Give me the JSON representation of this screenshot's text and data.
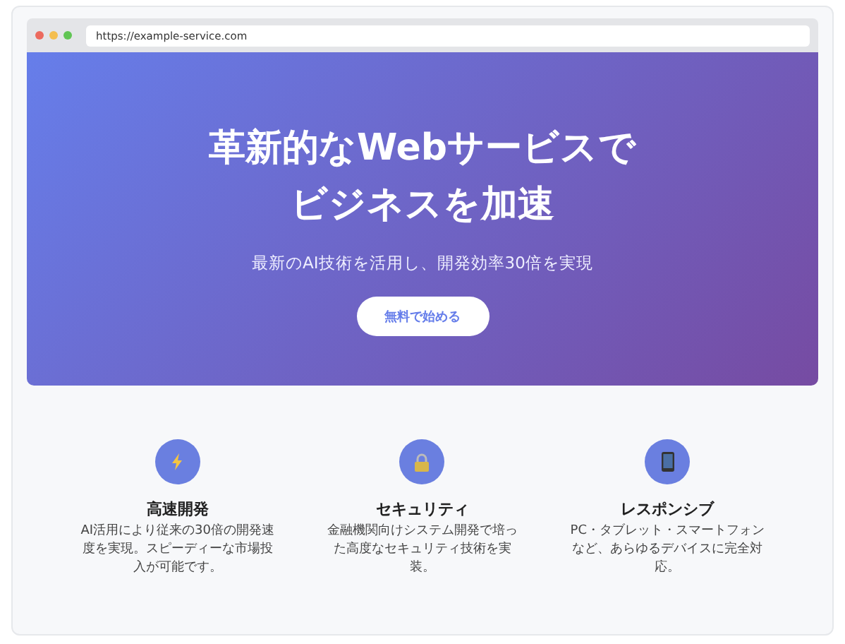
{
  "browser": {
    "url": "https://example-service.com"
  },
  "hero": {
    "title_lines": [
      "革新的なWebサービスで",
      "ビジネスを加速"
    ],
    "subtitle": "最新のAI技術を活用し、開発効率30倍を実現",
    "button": "無料で始める"
  },
  "features": [
    {
      "kind": "bolt",
      "title": "高速開発",
      "text": "AI活用により従来の30倍の開発速度を実現。スピーディーな市場投入が可能です。"
    },
    {
      "kind": "lock",
      "title": "セキュリティ",
      "text": "金融機関向けシステム開発で培った高度なセキュリティ技術を実装。"
    },
    {
      "kind": "phone",
      "title": "レスポンシブ",
      "text": "PC・タブレット・スマートフォンなど、あらゆるデバイスに完全対応。"
    }
  ]
}
